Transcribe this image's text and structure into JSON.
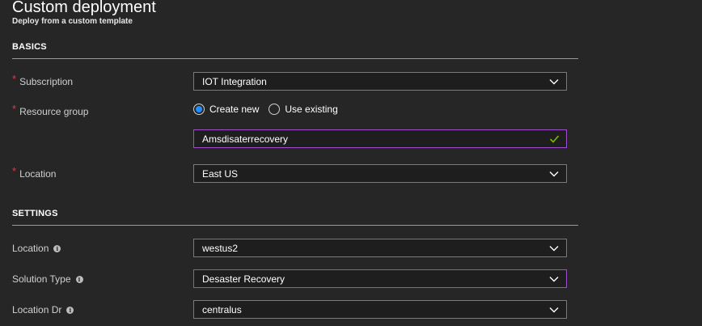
{
  "header": {
    "title": "Custom deployment",
    "subtitle": "Deploy from a custom template"
  },
  "basics": {
    "heading": "BASICS",
    "subscription": {
      "label": "Subscription",
      "value": "IOT Integration"
    },
    "resource_group": {
      "label": "Resource group",
      "option_new": "Create new",
      "option_existing": "Use existing",
      "selected": "Create new",
      "value": "Amsdisaterrecovery"
    },
    "location": {
      "label": "Location",
      "value": "East US"
    }
  },
  "settings": {
    "heading": "SETTINGS",
    "location": {
      "label": "Location",
      "value": "westus2"
    },
    "solution_type": {
      "label": "Solution Type",
      "value": "Desaster Recovery"
    },
    "location_dr": {
      "label": "Location Dr",
      "value": "centralus"
    }
  },
  "colors": {
    "background": "#262626",
    "required": "#e3384e",
    "focus_border": "#9b4fc9",
    "radio_selected": "#1e90ff",
    "valid_check": "#7fba00"
  }
}
